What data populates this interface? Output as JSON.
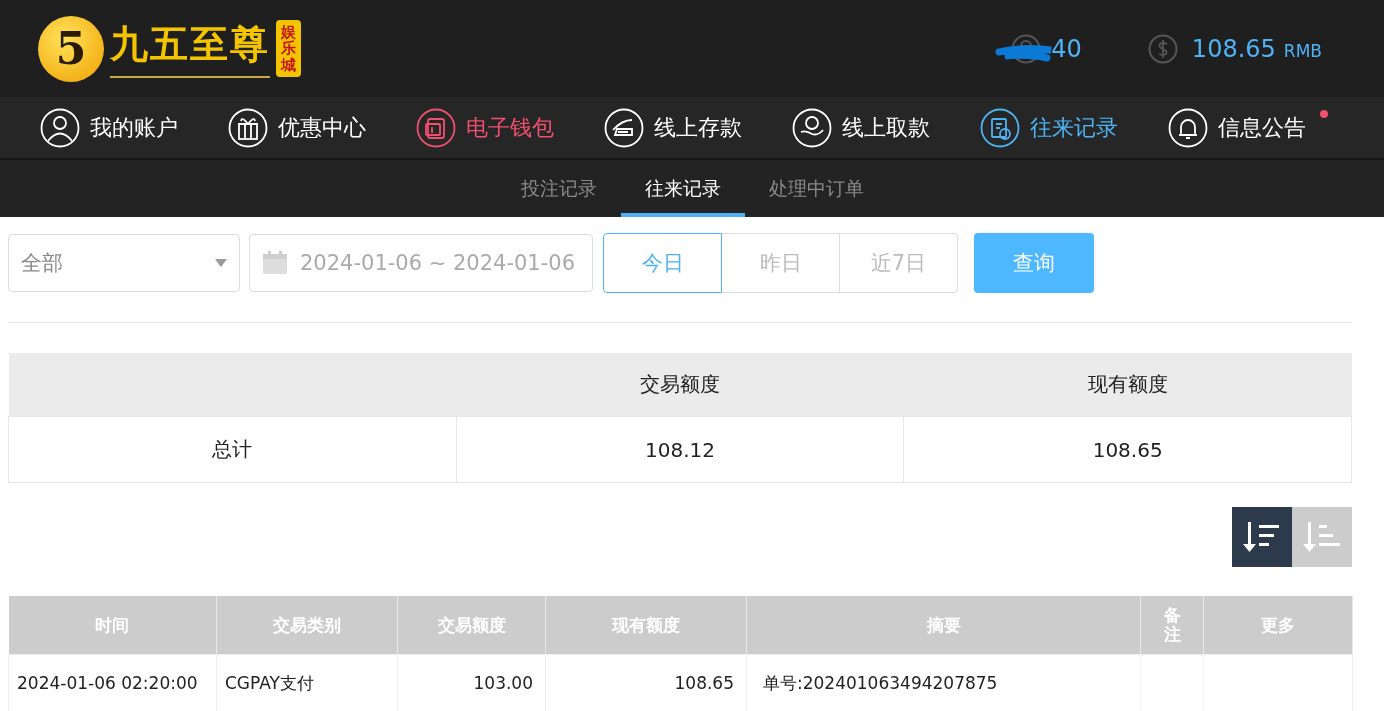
{
  "header": {
    "logo": {
      "mark": "5",
      "name": "九五至尊",
      "badge": "娱乐城"
    },
    "user": {
      "name": "40",
      "redacted": true
    },
    "balance": {
      "amount": "108.65",
      "currency": "RMB"
    }
  },
  "nav": [
    {
      "label": "我的账户",
      "color": "#ffffff",
      "dot": false
    },
    {
      "label": "优惠中心",
      "color": "#ffffff",
      "dot": false
    },
    {
      "label": "电子钱包",
      "color": "#f0506e",
      "dot": false
    },
    {
      "label": "线上存款",
      "color": "#ffffff",
      "dot": false
    },
    {
      "label": "线上取款",
      "color": "#ffffff",
      "dot": false
    },
    {
      "label": "往来记录",
      "color": "#4db3f5",
      "dot": false
    },
    {
      "label": "信息公告",
      "color": "#ffffff",
      "dot": true
    }
  ],
  "subnav": [
    {
      "label": "投注记录",
      "selected": false
    },
    {
      "label": "往来记录",
      "selected": true
    },
    {
      "label": "处理中订单",
      "selected": false
    }
  ],
  "filters": {
    "type": {
      "value": "全部"
    },
    "date_range": {
      "value": "2024-01-06 ~ 2024-01-06"
    },
    "quick_dates": [
      {
        "label": "今日",
        "selected": true
      },
      {
        "label": "昨日",
        "selected": false
      },
      {
        "label": "近7日",
        "selected": false
      }
    ],
    "search_button": "查询"
  },
  "summary": {
    "columns": [
      "",
      "交易额度",
      "现有额度"
    ],
    "rows": [
      [
        "总计",
        "108.12",
        "108.65"
      ]
    ]
  },
  "sort": [
    {
      "kind": "desc",
      "selected": true
    },
    {
      "kind": "asc",
      "selected": false
    }
  ],
  "table": {
    "columns": [
      "时间",
      "交易类别",
      "交易额度",
      "现有额度",
      "摘要",
      "备注",
      "更多"
    ],
    "rows": [
      [
        "2024-01-06 02:20:00",
        "CGPAY支付",
        "103.00",
        "108.65",
        "单号:202401063494207875",
        "",
        ""
      ]
    ]
  }
}
